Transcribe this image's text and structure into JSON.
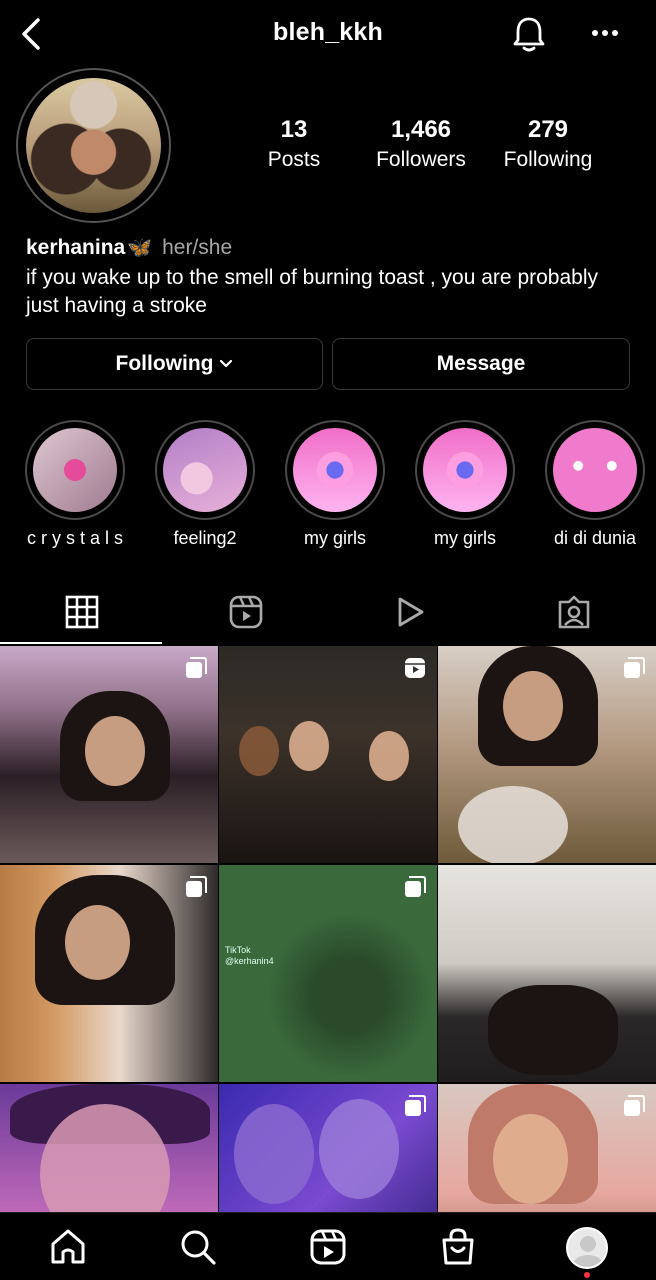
{
  "header": {
    "username": "bleh_kkh"
  },
  "profile": {
    "stats": [
      {
        "value": "13",
        "label": "Posts"
      },
      {
        "value": "1,466",
        "label": "Followers"
      },
      {
        "value": "279",
        "label": "Following"
      }
    ],
    "name": "kerhanina",
    "name_emoji": "🦋",
    "pronouns": "her/she",
    "bio": "if you wake up to the smell of burning toast , you are probably just having a stroke"
  },
  "actions": {
    "following_label": "Following",
    "message_label": "Message"
  },
  "highlights": [
    {
      "label": "c r y s t a l s"
    },
    {
      "label": "feeling2"
    },
    {
      "label": "my girls"
    },
    {
      "label": "my girls"
    },
    {
      "label": "di di dunia"
    }
  ],
  "tabs": [
    {
      "icon": "grid-icon",
      "active": true
    },
    {
      "icon": "reels-icon",
      "active": false
    },
    {
      "icon": "play-icon",
      "active": false
    },
    {
      "icon": "tagged-icon",
      "active": false
    }
  ],
  "grid": {
    "post_badges": [
      "carousel",
      "reel",
      "carousel",
      "carousel",
      "carousel",
      "none",
      "none",
      "carousel",
      "carousel"
    ],
    "tiktok_watermark": "TikTok",
    "tiktok_handle": "@kerhanin4"
  },
  "bottom_nav": [
    "home-icon",
    "search-icon",
    "reels-icon",
    "shop-icon",
    "profile-avatar"
  ],
  "colors": {
    "background": "#000000",
    "text": "#ffffff",
    "secondary_text": "#a8a8a8",
    "border": "#3a3a3a",
    "notification_dot": "#ff3040"
  }
}
